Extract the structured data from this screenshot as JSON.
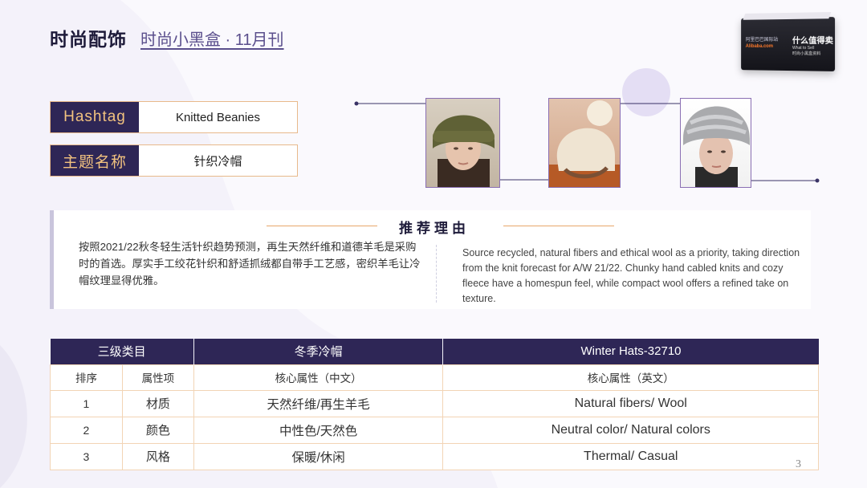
{
  "header": {
    "title": "时尚配饰",
    "subtitle": "时尚小黑盒 · 11月刊"
  },
  "logo": {
    "left_text": "阿里巴巴国际站",
    "left_brand": "Alibaba.com",
    "title": "什么值得卖",
    "subtitle_en": "What to Sell",
    "subtitle_cn": "时尚小黑盒资料"
  },
  "tags": [
    {
      "label": "Hashtag",
      "value": "Knitted Beanies"
    },
    {
      "label": "主题名称",
      "value": "针织冷帽"
    }
  ],
  "reason": {
    "title": "推荐理由",
    "cn": "按照2021/22秋冬轻生活针织趋势预测，再生天然纤维和道德羊毛是采购时的首选。厚实手工绞花针织和舒适抓绒都自带手工艺感，密织羊毛让冷帽纹理显得优雅。",
    "en": "Source recycled, natural fibers and ethical wool as a priority, taking direction from the knit forecast for A/W 21/22. Chunky hand cabled knits and cozy fleece have a homespun feel, while compact wool offers a refined take on texture."
  },
  "table": {
    "header": [
      "三级类目",
      "冬季冷帽",
      "Winter Hats-32710"
    ],
    "subheader": [
      "排序",
      "属性项",
      "核心属性（中文）",
      "核心属性（英文）"
    ],
    "rows": [
      {
        "idx": "1",
        "attr": "材质",
        "cn": "天然纤维/再生羊毛",
        "en": "Natural fibers/ Wool"
      },
      {
        "idx": "2",
        "attr": "颜色",
        "cn": "中性色/天然色",
        "en": "Neutral color/ Natural colors"
      },
      {
        "idx": "3",
        "attr": "风格",
        "cn": "保暖/休闲",
        "en": "Thermal/ Casual"
      }
    ]
  },
  "page_number": "3",
  "colors": {
    "navy": "#2e2656",
    "gold": "#f2c27f",
    "accent_line": "#e8a76a",
    "table_border": "#f2d4b5"
  }
}
